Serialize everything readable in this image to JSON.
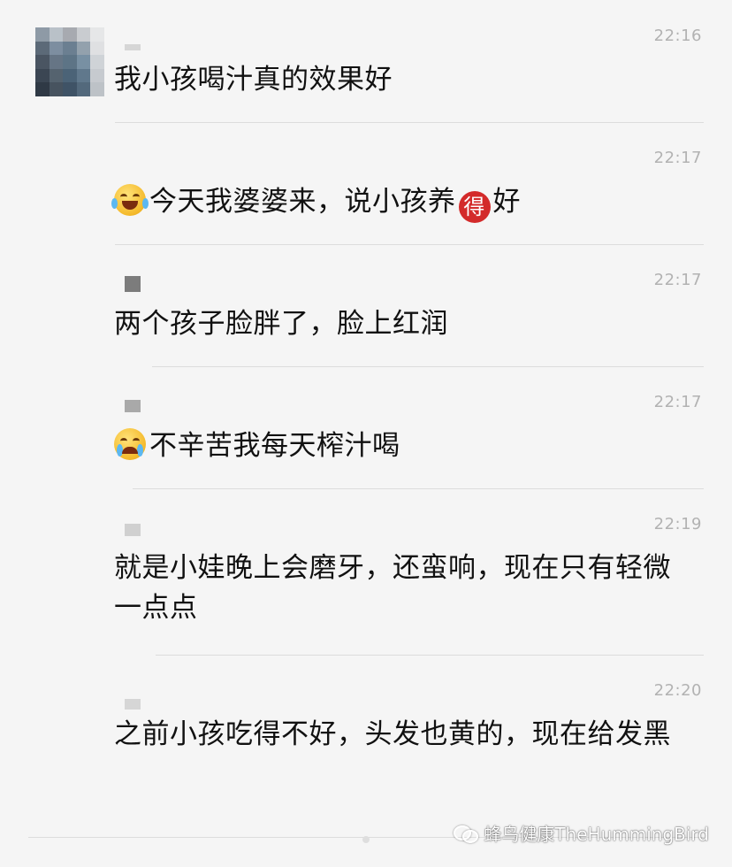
{
  "messages": [
    {
      "time": "22:16",
      "text": "我小孩喝汁真的效果好"
    },
    {
      "time": "22:17",
      "emoji": "tears-of-joy-emoji",
      "text_before": "今天我婆婆来，说小孩养",
      "badge": "得",
      "text_after": "好"
    },
    {
      "time": "22:17",
      "text": "两个孩子脸胖了，脸上红润"
    },
    {
      "time": "22:17",
      "emoji": "crying-emoji",
      "text": "不辛苦我每天榨汁喝"
    },
    {
      "time": "22:19",
      "text": "就是小娃晚上会磨牙，还蛮响，现在只有轻微一点点"
    },
    {
      "time": "22:20",
      "text": "之前小孩吃得不好，头发也黄的，现在给发黑"
    }
  ],
  "watermark": {
    "icon": "wechat-icon",
    "text": "蜂鸟健康TheHummingBird"
  },
  "colors": {
    "background": "#f5f5f5",
    "timestamp": "#b2b2b2",
    "divider": "#dcdcdc",
    "badge": "#d32a2a"
  }
}
